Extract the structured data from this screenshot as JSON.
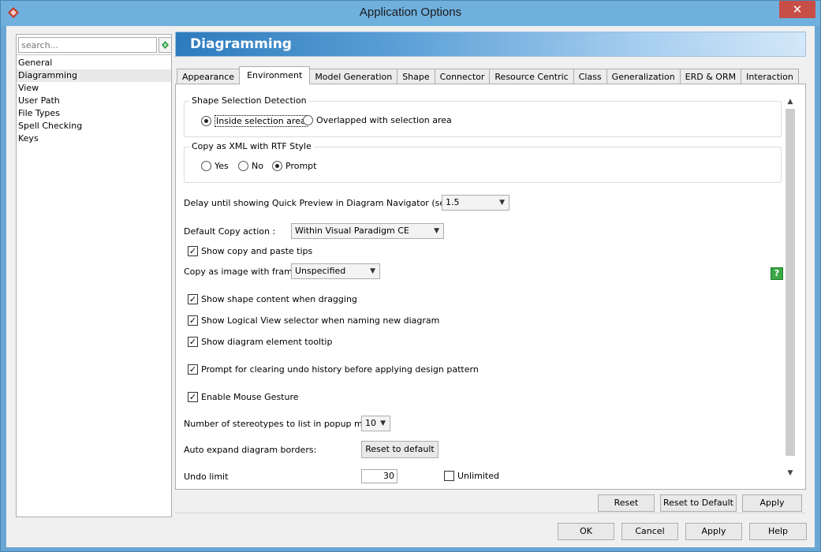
{
  "window": {
    "title": "Application Options",
    "close_symbol": "✕"
  },
  "search": {
    "placeholder": "search..."
  },
  "nav": {
    "items": [
      "General",
      "Diagramming",
      "View",
      "User Path",
      "File Types",
      "Spell Checking",
      "Keys"
    ],
    "selected": "Diagramming"
  },
  "header": {
    "title": "Diagramming"
  },
  "tabs": {
    "items": [
      "Appearance",
      "Environment",
      "Model Generation",
      "Shape",
      "Connector",
      "Resource Centric",
      "Class",
      "Generalization",
      "ERD & ORM",
      "Interaction"
    ],
    "active": "Environment"
  },
  "shape_selection": {
    "label": "Shape Selection Detection",
    "option_inside": "Inside selection area",
    "option_overlapped": "Overlapped with selection area",
    "selected": "Inside selection area"
  },
  "copy_xml": {
    "label": "Copy as XML with RTF Style",
    "option_yes": "Yes",
    "option_no": "No",
    "option_prompt": "Prompt",
    "selected": "Prompt"
  },
  "delay": {
    "label": "Delay until showing Quick Preview in Diagram Navigator (seconds) :",
    "value": "1.5"
  },
  "default_copy": {
    "label": "Default Copy action :",
    "value": "Within Visual Paradigm CE"
  },
  "show_copy_paste_tips": {
    "label": "Show copy and paste tips",
    "checked": true
  },
  "copy_image_frame": {
    "label": "Copy as image with frame :",
    "value": "Unspecified"
  },
  "help_symbol": "?",
  "show_shape_content": {
    "label": "Show shape content when dragging",
    "checked": true
  },
  "show_logical_view": {
    "label": "Show Logical View selector when naming new diagram",
    "checked": true
  },
  "show_tooltip": {
    "label": "Show diagram element tooltip",
    "checked": true
  },
  "prompt_undo": {
    "label": "Prompt for clearing undo history before applying design pattern",
    "checked": true
  },
  "mouse_gesture": {
    "label": "Enable Mouse Gesture",
    "checked": true
  },
  "stereotypes": {
    "label": "Number of stereotypes to list in popup menu :",
    "value": "10"
  },
  "auto_expand": {
    "label": "Auto expand diagram borders:",
    "button": "Reset to default"
  },
  "undo_limit": {
    "label": "Undo limit",
    "value": "30",
    "unlimited_label": "Unlimited",
    "unlimited_checked": false
  },
  "panel_buttons": {
    "reset": "Reset",
    "reset_to_default": "Reset to Default",
    "apply": "Apply"
  },
  "dialog_buttons": {
    "ok": "OK",
    "cancel": "Cancel",
    "apply": "Apply",
    "help": "Help"
  },
  "colors": {
    "titlebar": "#6fb0de",
    "close": "#c74e47",
    "header_start": "#2d7bbd",
    "help_icon": "#3aa845"
  }
}
